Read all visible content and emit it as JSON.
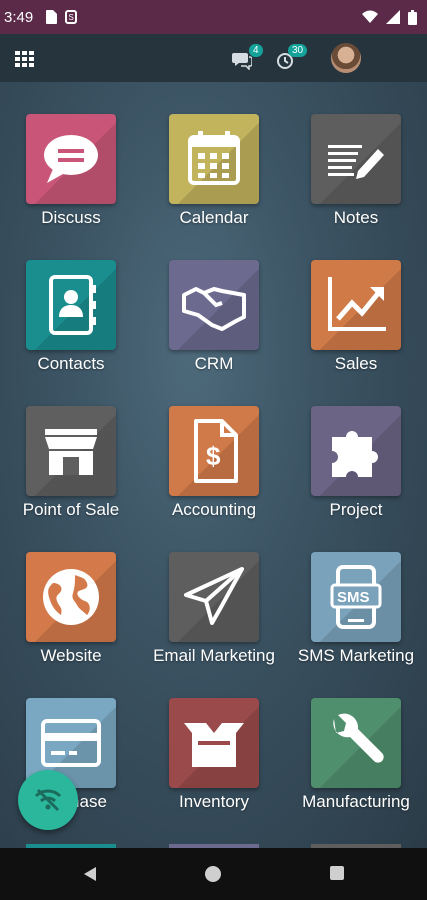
{
  "status_bar": {
    "time": "3:49"
  },
  "top_bar": {
    "messages_count": "4",
    "activities_count": "30"
  },
  "apps": [
    {
      "label": "Discuss",
      "color": "#c95678",
      "icon": "chat-bubble-icon"
    },
    {
      "label": "Calendar",
      "color": "#c2b35d",
      "icon": "calendar-icon"
    },
    {
      "label": "Notes",
      "color": "#5e5e5e",
      "icon": "notes-pencil-icon"
    },
    {
      "label": "Contacts",
      "color": "#1a8d8f",
      "icon": "address-book-icon"
    },
    {
      "label": "CRM",
      "color": "#6c6a8f",
      "icon": "handshake-icon"
    },
    {
      "label": "Sales",
      "color": "#d07a48",
      "icon": "trend-chart-icon"
    },
    {
      "label": "Point of Sale",
      "color": "#5f5f5f",
      "icon": "store-icon"
    },
    {
      "label": "Accounting",
      "color": "#d17a49",
      "icon": "invoice-dollar-icon"
    },
    {
      "label": "Project",
      "color": "#6b6485",
      "icon": "puzzle-icon"
    },
    {
      "label": "Website",
      "color": "#d47a4a",
      "icon": "globe-icon"
    },
    {
      "label": "Email Marketing",
      "color": "#5e5e5e",
      "icon": "paper-plane-icon"
    },
    {
      "label": "SMS Marketing",
      "color": "#7aa3bb",
      "icon": "sms-phone-icon"
    },
    {
      "label": "Purchase",
      "color": "#7aa7c2",
      "icon": "credit-card-icon"
    },
    {
      "label": "Inventory",
      "color": "#9a4a4a",
      "icon": "open-box-icon"
    },
    {
      "label": "Manufacturing",
      "color": "#4f8f6d",
      "icon": "wrench-icon"
    }
  ],
  "fab": {
    "icon": "wifi-off-icon",
    "color": "#2ab79b"
  }
}
